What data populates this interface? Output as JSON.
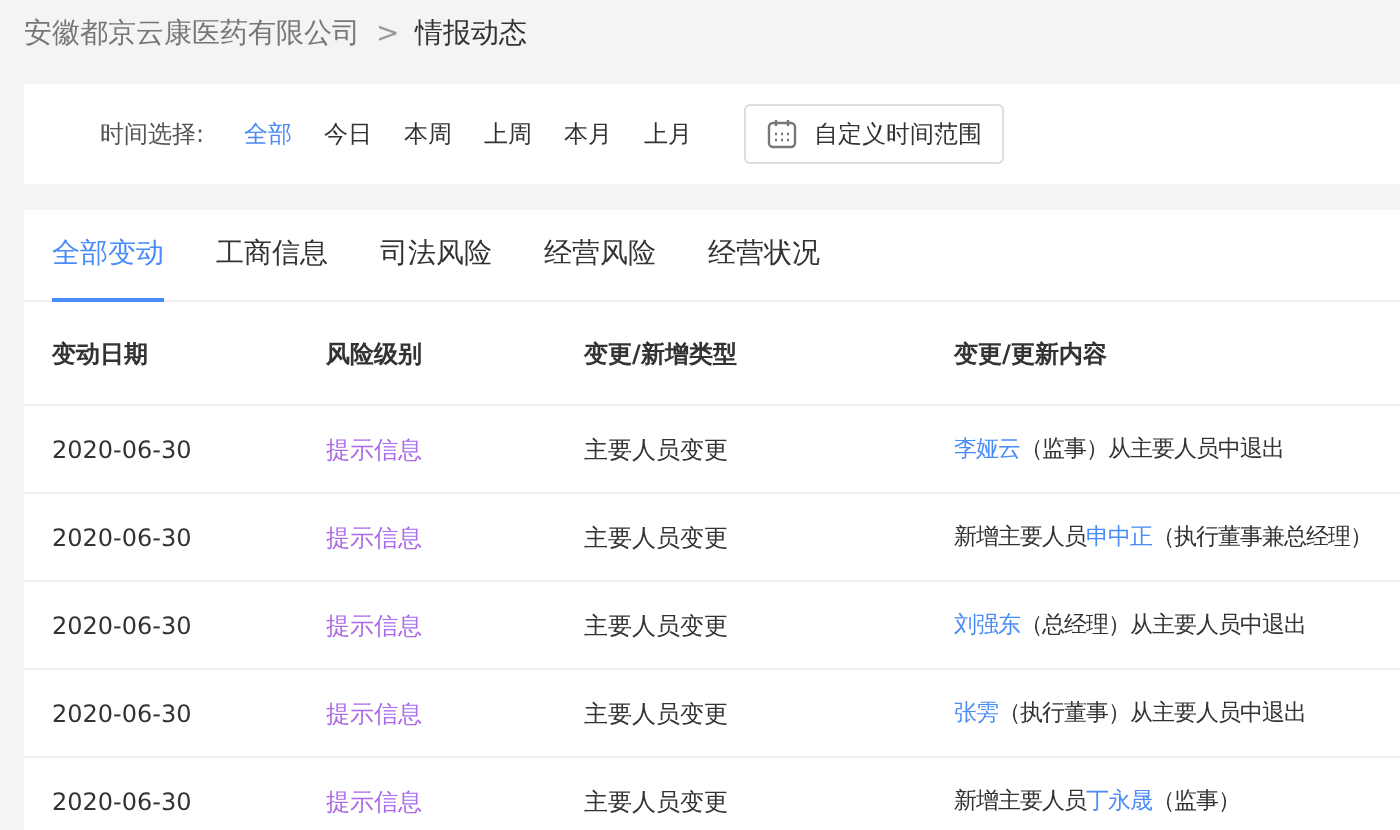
{
  "breadcrumb": {
    "parent": "安徽都京云康医药有限公司",
    "separator": ">",
    "current": "情报动态"
  },
  "time_filter": {
    "label": "时间选择:",
    "options": [
      {
        "label": "全部",
        "selected": true
      },
      {
        "label": "今日",
        "selected": false
      },
      {
        "label": "本周",
        "selected": false
      },
      {
        "label": "上周",
        "selected": false
      },
      {
        "label": "本月",
        "selected": false
      },
      {
        "label": "上月",
        "selected": false
      }
    ],
    "custom_range_button": "自定义时间范围"
  },
  "tabs": [
    {
      "label": "全部变动",
      "selected": true
    },
    {
      "label": "工商信息",
      "selected": false
    },
    {
      "label": "司法风险",
      "selected": false
    },
    {
      "label": "经营风险",
      "selected": false
    },
    {
      "label": "经营状况",
      "selected": false
    }
  ],
  "table": {
    "columns": [
      "变动日期",
      "风险级别",
      "变更/新增类型",
      "变更/更新内容"
    ],
    "rows": [
      {
        "date": "2020-06-30",
        "risk_level": "提示信息",
        "type": "主要人员变更",
        "content": [
          {
            "text": "李娅云",
            "link": true
          },
          {
            "text": "（监事）从主要人员中退出",
            "link": false
          }
        ]
      },
      {
        "date": "2020-06-30",
        "risk_level": "提示信息",
        "type": "主要人员变更",
        "content": [
          {
            "text": "新增主要人员",
            "link": false
          },
          {
            "text": "申中正",
            "link": true
          },
          {
            "text": "（执行董事兼总经理）",
            "link": false
          }
        ]
      },
      {
        "date": "2020-06-30",
        "risk_level": "提示信息",
        "type": "主要人员变更",
        "content": [
          {
            "text": "刘强东",
            "link": true
          },
          {
            "text": "（总经理）从主要人员中退出",
            "link": false
          }
        ]
      },
      {
        "date": "2020-06-30",
        "risk_level": "提示信息",
        "type": "主要人员变更",
        "content": [
          {
            "text": "张雱",
            "link": true
          },
          {
            "text": "（执行董事）从主要人员中退出",
            "link": false
          }
        ]
      },
      {
        "date": "2020-06-30",
        "risk_level": "提示信息",
        "type": "主要人员变更",
        "content": [
          {
            "text": "新增主要人员",
            "link": false
          },
          {
            "text": "丁永晟",
            "link": true
          },
          {
            "text": "（监事）",
            "link": false
          }
        ]
      }
    ]
  }
}
